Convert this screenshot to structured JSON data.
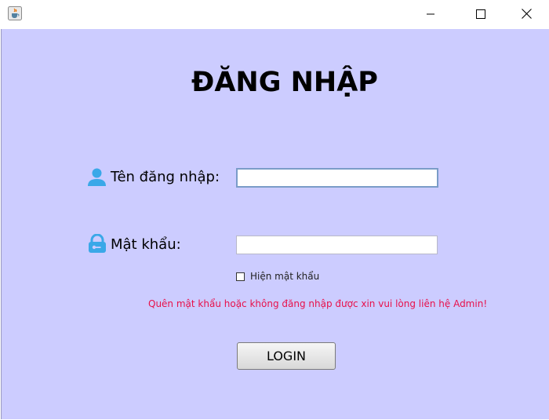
{
  "window": {
    "app_icon": "java-cup-icon",
    "controls": [
      "minimize-icon",
      "maximize-icon",
      "close-icon"
    ]
  },
  "form": {
    "heading": "ĐĂNG NHẬP",
    "username": {
      "label": "Tên đăng nhập:",
      "icon": "user-icon",
      "value": "",
      "focused": true
    },
    "password": {
      "label": "Mật khẩu:",
      "icon": "lock-icon",
      "value": ""
    },
    "show_password": {
      "label": "Hiện mật khẩu",
      "checked": false
    },
    "hint": "Quên mật khẩu hoặc không đăng nhập được xin vui lòng liên hệ Admin!",
    "login_label": "LOGIN"
  },
  "colors": {
    "background": "#ccccff",
    "icon": "#3aa8e8",
    "hint": "#e8104a"
  }
}
